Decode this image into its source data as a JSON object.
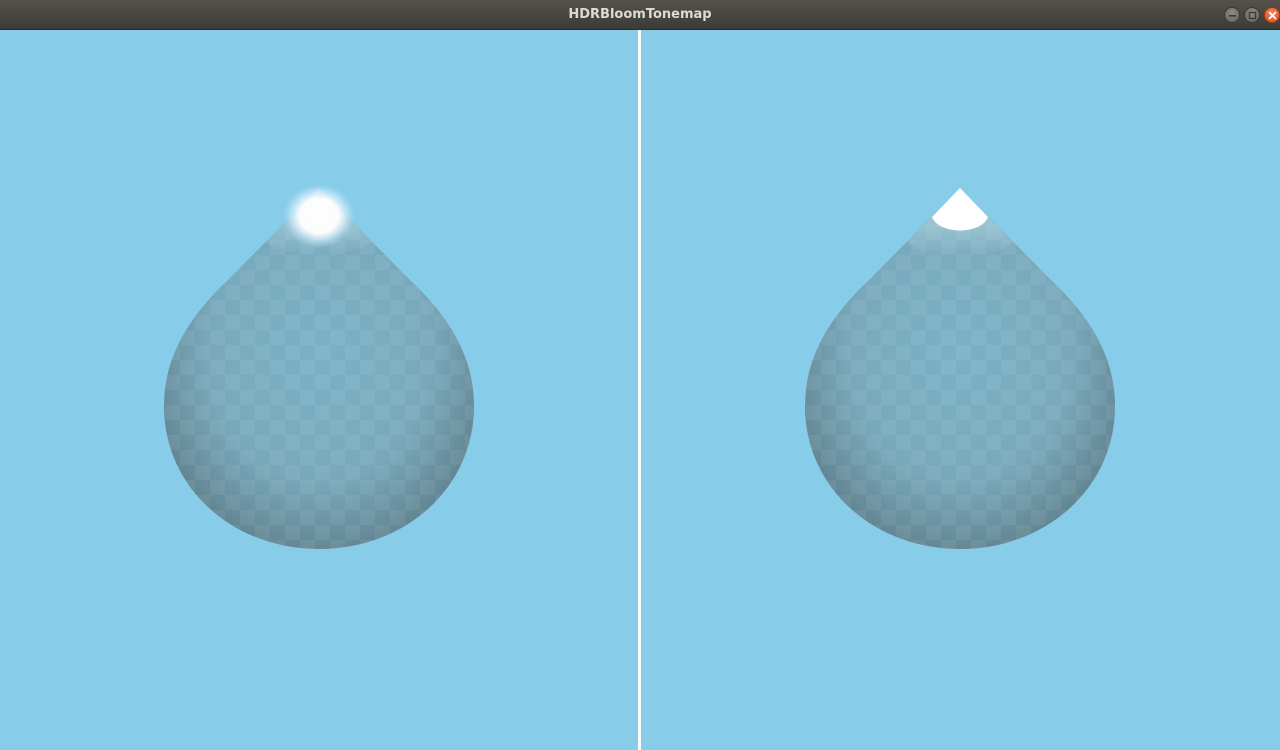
{
  "window": {
    "title": "HDRBloomTonemap",
    "controls": [
      "minimize-icon",
      "maximize-icon",
      "close-icon"
    ]
  },
  "colors": {
    "background": "#87cce9",
    "divider": "#ffffff",
    "drop_body": "#78aabd",
    "drop_edge": "#6d8e9c",
    "highlight": "#ffffff",
    "close_button": "#e2521f"
  },
  "viewports": [
    {
      "id": "left",
      "mode": "bloom"
    },
    {
      "id": "right",
      "mode": "no-bloom"
    }
  ]
}
